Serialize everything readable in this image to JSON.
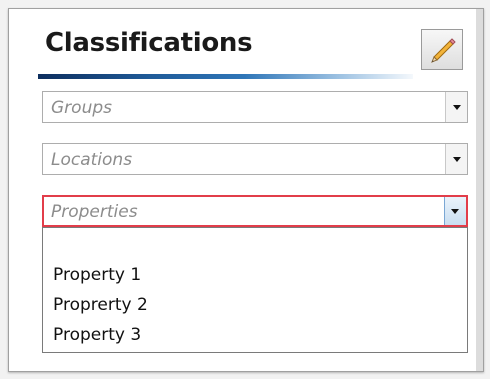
{
  "panel": {
    "title": "Classifications",
    "edit_icon": "pencil-icon"
  },
  "filters": {
    "groups": {
      "placeholder": "Groups"
    },
    "locations": {
      "placeholder": "Locations"
    },
    "properties": {
      "placeholder": "Properties",
      "options": [
        "Property 1",
        "Proprerty 2",
        "Property 3"
      ]
    }
  },
  "colors": {
    "accent_bar_dark": "#0d2e5e",
    "accent_bar_mid": "#2f76b8",
    "focus_border": "#e23d4a"
  }
}
